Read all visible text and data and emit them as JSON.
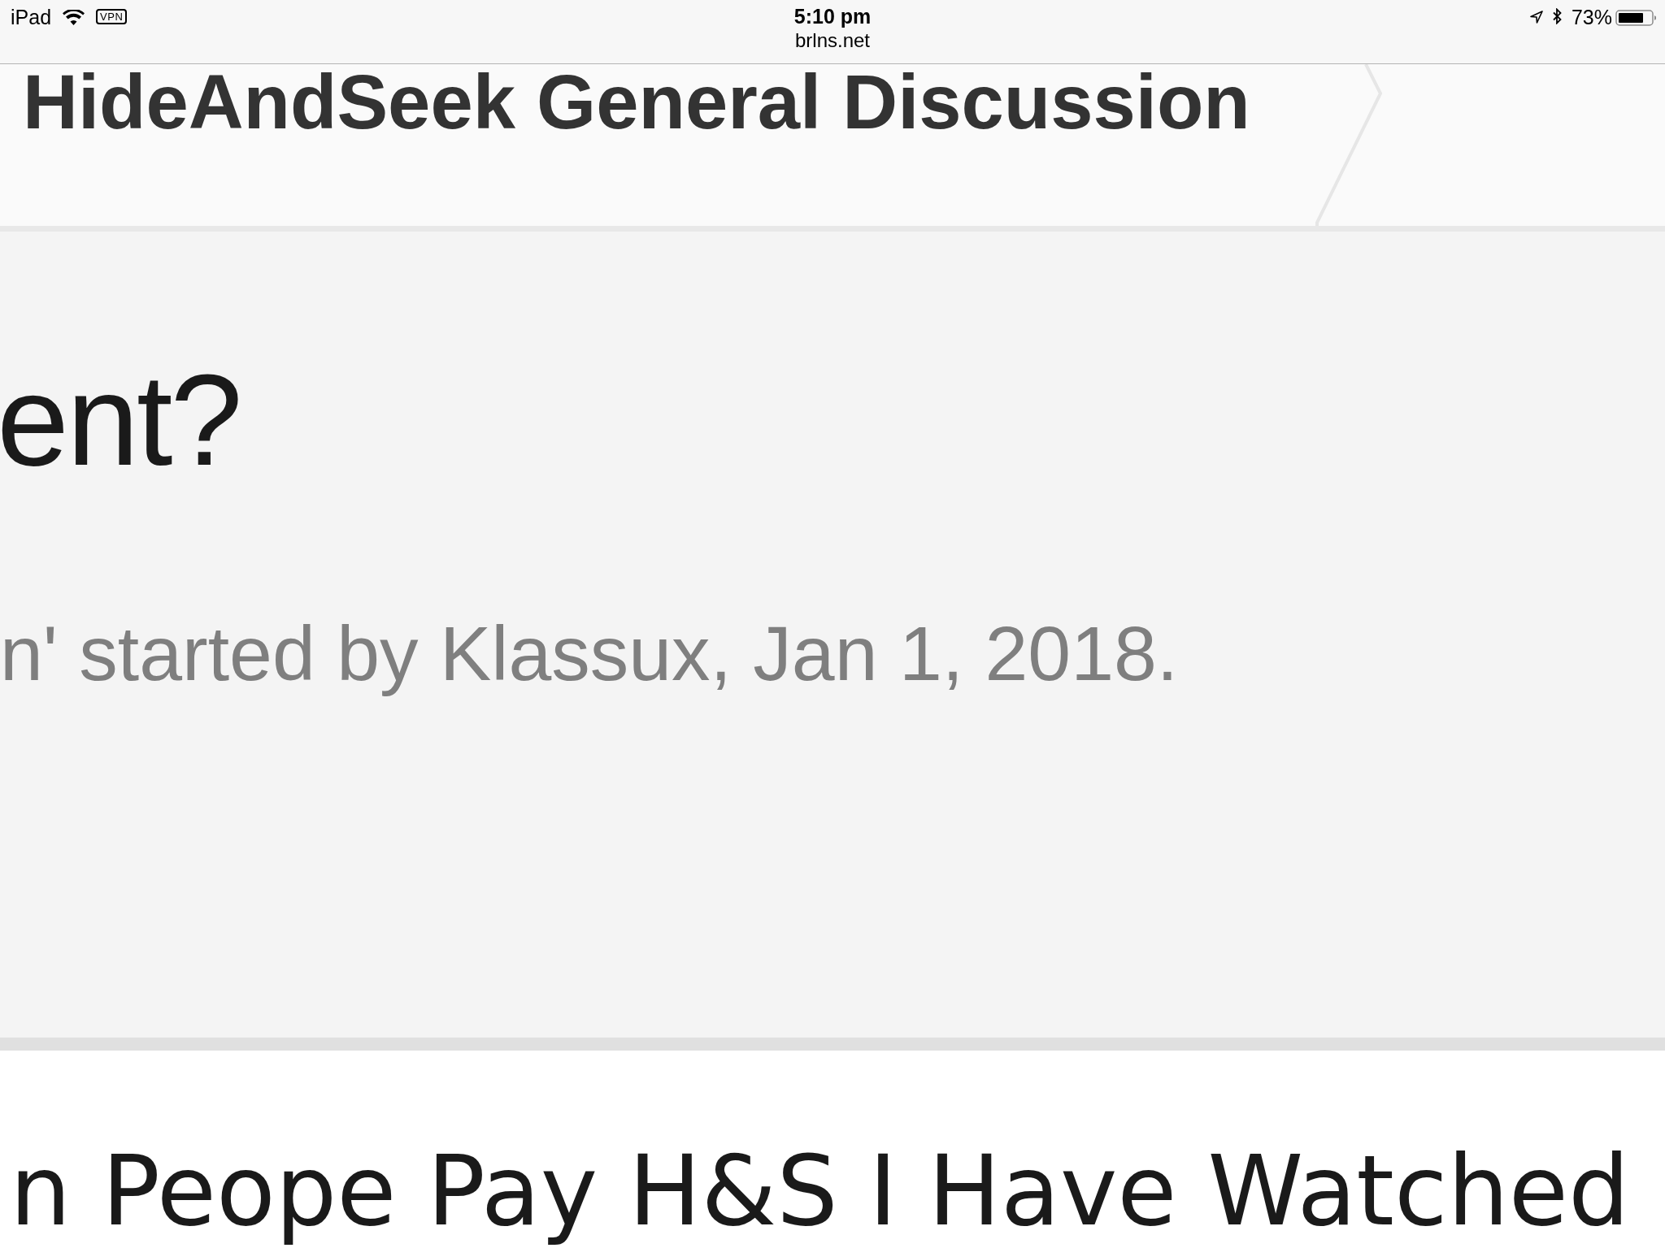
{
  "status_bar": {
    "device": "iPad",
    "vpn": "VPN",
    "time": "5:10 pm",
    "url": "brlns.net",
    "battery": "73%"
  },
  "breadcrumb": {
    "title": "HideAndSeek General Discussion"
  },
  "thread_header": {
    "title": "ent?",
    "meta": "n' started by Klassux, Jan 1, 2018."
  },
  "thread_list": [
    {
      "title": "n Peope Pay H&S I Have Watched"
    }
  ]
}
